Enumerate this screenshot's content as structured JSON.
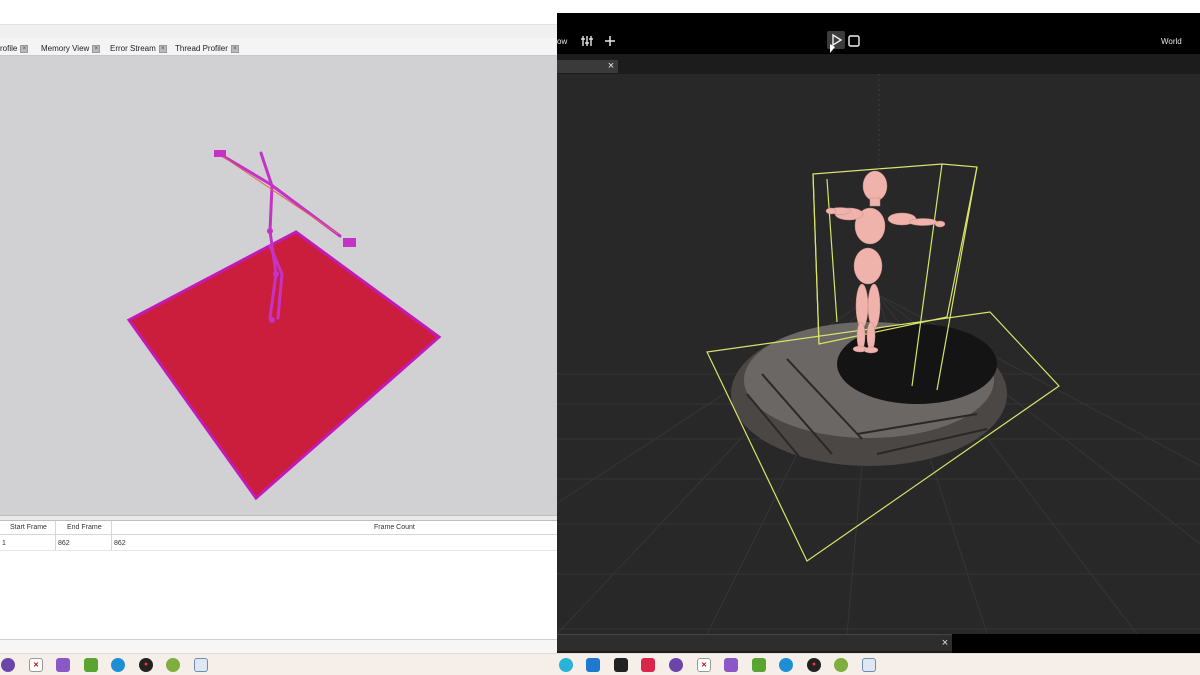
{
  "left_window": {
    "tabs": [
      {
        "label": "rofile"
      },
      {
        "label": "Memory View"
      },
      {
        "label": "Error Stream"
      },
      {
        "label": "Thread Profiler"
      }
    ],
    "tab_close_glyph": "×",
    "viewport": {
      "background": "#d1d0d3",
      "plane_color": "#cb1e3c",
      "plane_edge_color": "#c21ab8",
      "skeleton_color": "#c433c6"
    },
    "frame_table": {
      "headers": {
        "start_frame": "Start Frame",
        "end_frame": "End Frame",
        "frame_count": "Frame Count"
      },
      "rows": [
        {
          "index": "1",
          "end_frame": "862",
          "frame_count": "862"
        }
      ]
    }
  },
  "right_window": {
    "toolbar": {
      "partial_label": "ow",
      "sliders_icon": "sliders-icon",
      "add_icon": "plus-icon",
      "play_icon": "play-icon",
      "stop_icon": "stop-icon",
      "space_label": "World"
    },
    "close_glyph": "×",
    "viewport": {
      "background": "#282828",
      "bounds_color": "#d8e36a",
      "character_color": "#f0b3ac",
      "floor_grid_color": "#3a3a3a"
    }
  },
  "taskbar": {
    "left_icons": [
      "github-icon",
      "cross-icon",
      "visual-studio-icon",
      "puzzle-icon",
      "edge-icon",
      "ladybug-icon",
      "orb-icon",
      "window-icon"
    ],
    "right_icons": [
      "gear-blue-icon",
      "vscode-icon",
      "epic-games-icon",
      "jetbrains-icon",
      "github-icon",
      "cross-icon",
      "visual-studio-icon",
      "puzzle-icon",
      "edge-icon",
      "ladybug-icon",
      "orb-icon",
      "window-icon"
    ]
  }
}
